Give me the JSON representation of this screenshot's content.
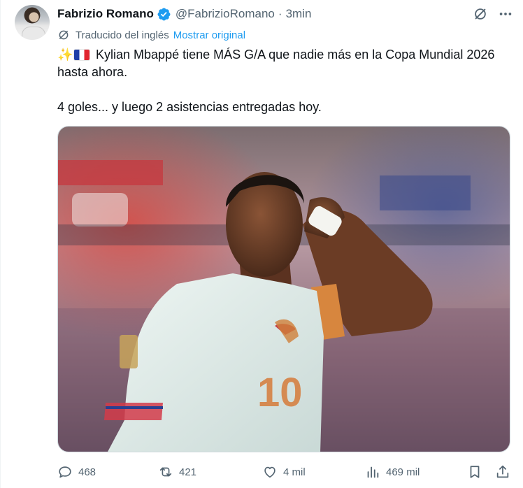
{
  "author": {
    "name": "Fabrizio Romano",
    "handle": "@FabrizioRomano",
    "separator": "·",
    "time": "3min",
    "verified_color": "#1d9bf0"
  },
  "translation": {
    "label": "Traducido del inglés",
    "show_original": "Mostrar original"
  },
  "tweet": {
    "line1": "Kylian Mbappé tiene MÁS G/A que nadie más en la Copa Mundial 2026 hasta ahora.",
    "line2": "4 goles... y luego 2 asistencias entregadas hoy.",
    "emoji": [
      "sparkles",
      "flag-france"
    ]
  },
  "media": {
    "icon": "photo-player"
  },
  "actions": {
    "replies": "468",
    "retweets": "421",
    "likes": "4 mil",
    "views": "469 mil"
  },
  "colors": {
    "text": "#0f1419",
    "secondary": "#536471",
    "accent": "#1d9bf0"
  }
}
